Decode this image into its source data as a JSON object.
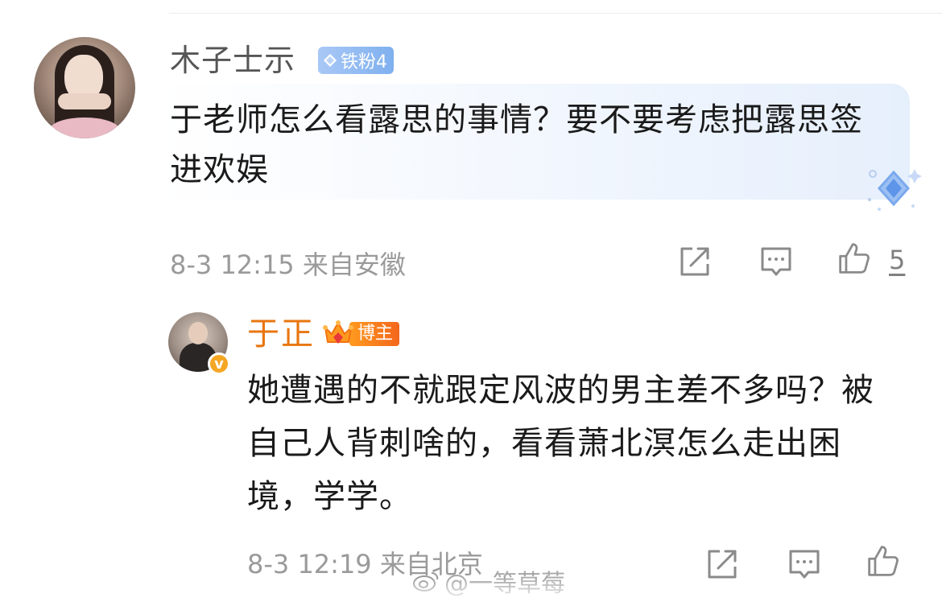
{
  "comments": [
    {
      "username": "木子士示",
      "badge": {
        "label": "铁粉4",
        "color": "#8db8f2",
        "icon": "diamond-icon"
      },
      "text": "于老师怎么看露思的事情？要不要考虑把露思签进欢娱",
      "time": "8-3 12:15",
      "location": "来自安徽",
      "likes": "5",
      "avatar": "avatar-photo-woman"
    },
    {
      "username": "于正",
      "badge": {
        "label": "博主",
        "color": "#f57c1f",
        "icon": "crown-icon"
      },
      "verified": true,
      "text": "她遭遇的不就跟定风波的男主差不多吗？被自己人背刺啥的，看看萧北溟怎么走出困境，学学。",
      "time": "8-3 12:19",
      "location": "来自北京",
      "avatar": "avatar-photo-man"
    }
  ],
  "watermark": "@一等草莓",
  "colors": {
    "name_reply": "#e8760f",
    "meta_text": "#9a9a9a",
    "bubble_tint": "#e6effc"
  }
}
